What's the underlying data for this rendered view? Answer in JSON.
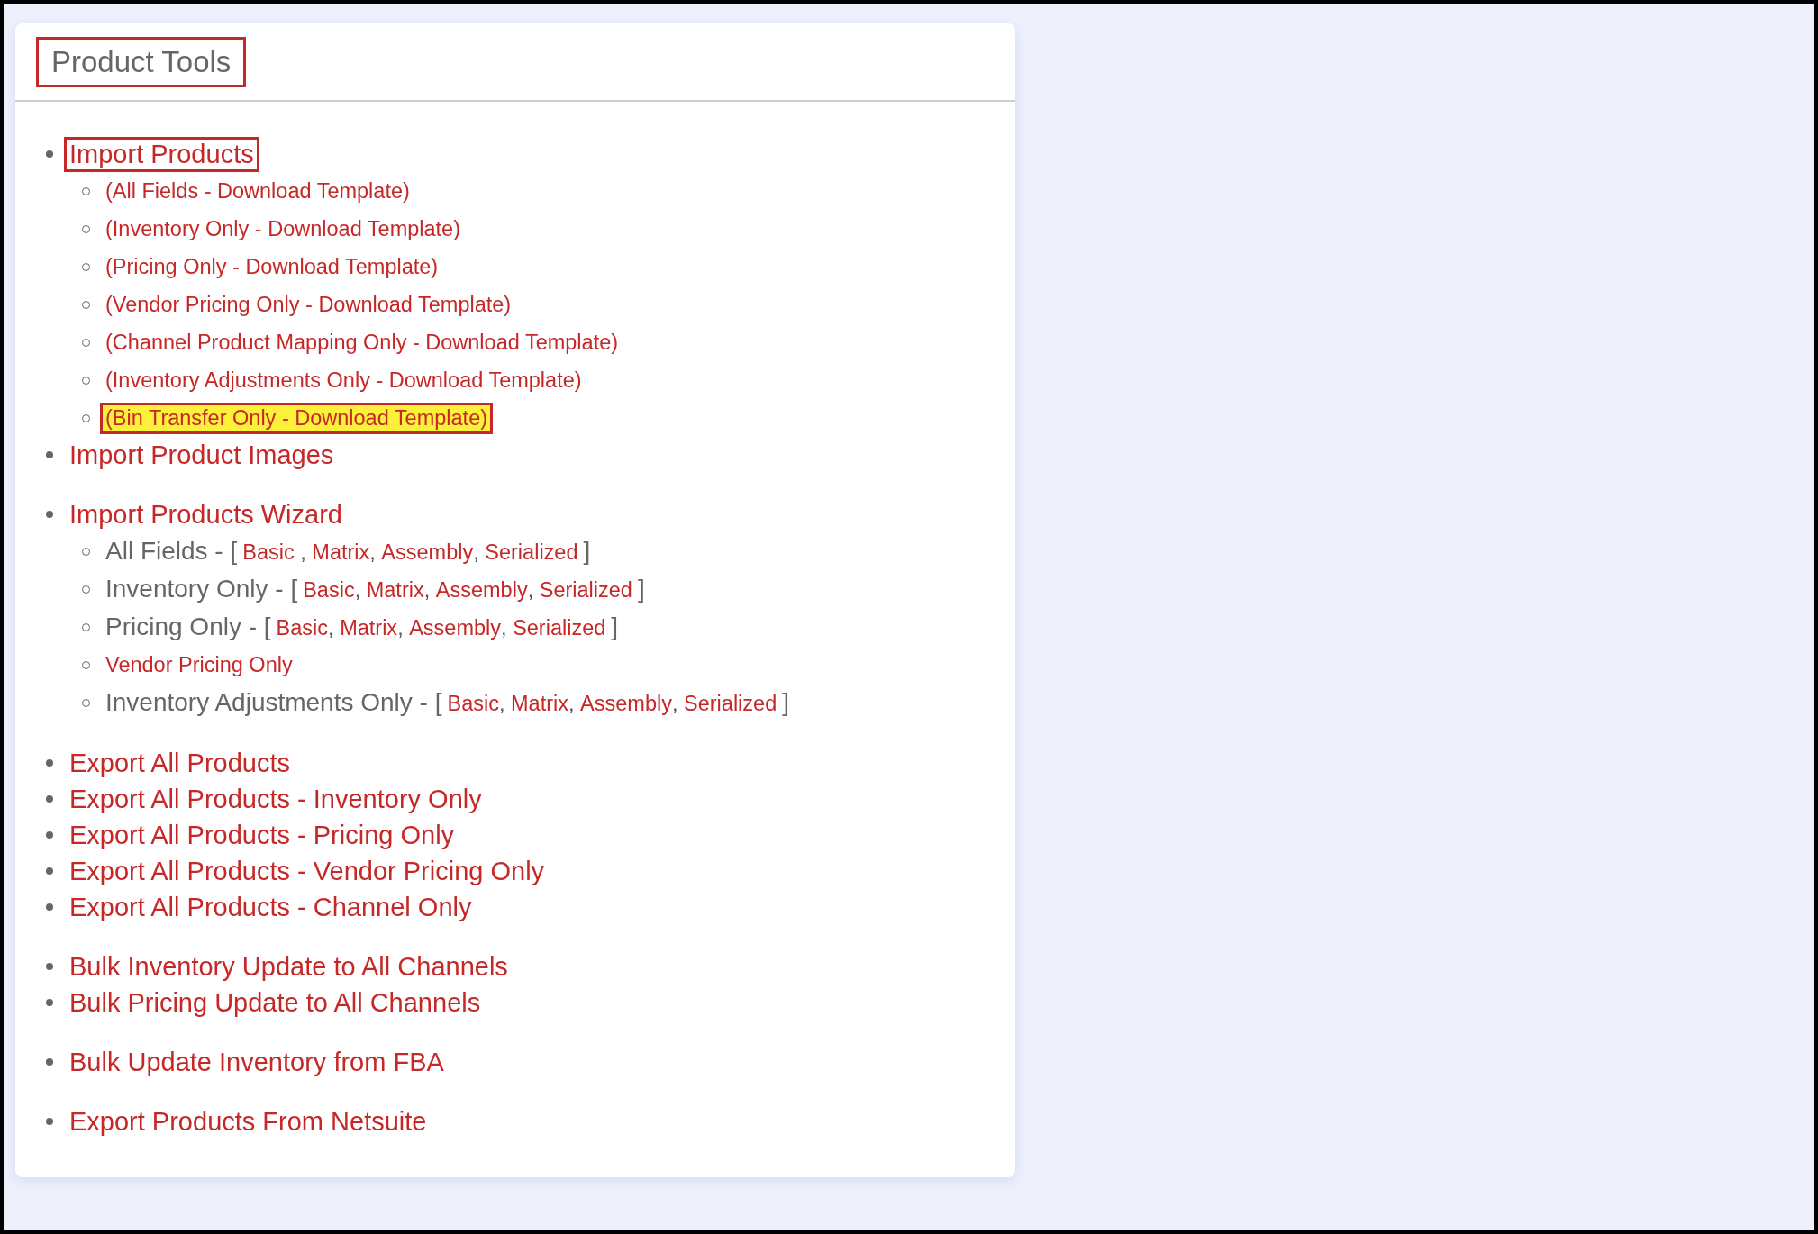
{
  "panel": {
    "title": "Product Tools",
    "outlined": true
  },
  "groups": [
    {
      "items": [
        {
          "label": "Import Products",
          "outlined": true,
          "children": [
            {
              "kind": "link",
              "highlighted": false,
              "parts": [
                {
                  "kind": "link",
                  "text": "(All Fields - Download Template)"
                }
              ]
            },
            {
              "kind": "link",
              "highlighted": false,
              "parts": [
                {
                  "kind": "link",
                  "text": "(Inventory Only - Download Template)"
                }
              ]
            },
            {
              "kind": "link",
              "highlighted": false,
              "parts": [
                {
                  "kind": "link",
                  "text": "(Pricing Only - Download Template)"
                }
              ]
            },
            {
              "kind": "link",
              "highlighted": false,
              "parts": [
                {
                  "kind": "link",
                  "text": "(Vendor Pricing Only - Download Template)"
                }
              ]
            },
            {
              "kind": "link",
              "highlighted": false,
              "parts": [
                {
                  "kind": "link",
                  "text": "(Channel Product Mapping Only - Download Template)"
                }
              ]
            },
            {
              "kind": "link",
              "highlighted": false,
              "parts": [
                {
                  "kind": "link",
                  "text": "(Inventory Adjustments Only - Download Template)"
                }
              ]
            },
            {
              "kind": "link",
              "highlighted": true,
              "parts": [
                {
                  "kind": "link",
                  "text": "(Bin Transfer Only - Download Template)"
                }
              ]
            }
          ]
        },
        {
          "label": "Import Product Images",
          "outlined": false
        }
      ]
    },
    {
      "items": [
        {
          "label": "Import Products Wizard",
          "outlined": false,
          "children": [
            {
              "kind": "wizard",
              "highlighted": false,
              "parts": [
                {
                  "kind": "label",
                  "text": "All Fields - ["
                },
                {
                  "kind": "link",
                  "text": "Basic"
                },
                {
                  "kind": "sep",
                  "text": " , "
                },
                {
                  "kind": "link",
                  "text": "Matrix"
                },
                {
                  "kind": "sep",
                  "text": ", "
                },
                {
                  "kind": "link",
                  "text": "Assembly"
                },
                {
                  "kind": "sep",
                  "text": ", "
                },
                {
                  "kind": "link",
                  "text": "Serialized"
                },
                {
                  "kind": "label",
                  "text": "]"
                }
              ]
            },
            {
              "kind": "wizard",
              "highlighted": false,
              "parts": [
                {
                  "kind": "label",
                  "text": "Inventory Only - ["
                },
                {
                  "kind": "link",
                  "text": "Basic"
                },
                {
                  "kind": "sep",
                  "text": ", "
                },
                {
                  "kind": "link",
                  "text": "Matrix"
                },
                {
                  "kind": "sep",
                  "text": ", "
                },
                {
                  "kind": "link",
                  "text": "Assembly"
                },
                {
                  "kind": "sep",
                  "text": ", "
                },
                {
                  "kind": "link",
                  "text": "Serialized"
                },
                {
                  "kind": "label",
                  "text": "]"
                }
              ]
            },
            {
              "kind": "wizard",
              "highlighted": false,
              "parts": [
                {
                  "kind": "label",
                  "text": "Pricing Only - ["
                },
                {
                  "kind": "link",
                  "text": "Basic"
                },
                {
                  "kind": "sep",
                  "text": ", "
                },
                {
                  "kind": "link",
                  "text": "Matrix"
                },
                {
                  "kind": "sep",
                  "text": ", "
                },
                {
                  "kind": "link",
                  "text": "Assembly"
                },
                {
                  "kind": "sep",
                  "text": ", "
                },
                {
                  "kind": "link",
                  "text": "Serialized"
                },
                {
                  "kind": "label",
                  "text": "]"
                }
              ]
            },
            {
              "kind": "link",
              "highlighted": false,
              "parts": [
                {
                  "kind": "link",
                  "text": "Vendor Pricing Only"
                }
              ]
            },
            {
              "kind": "wizard",
              "highlighted": false,
              "parts": [
                {
                  "kind": "label",
                  "text": "Inventory Adjustments Only - ["
                },
                {
                  "kind": "link",
                  "text": "Basic"
                },
                {
                  "kind": "sep",
                  "text": ", "
                },
                {
                  "kind": "link",
                  "text": "Matrix"
                },
                {
                  "kind": "sep",
                  "text": ", "
                },
                {
                  "kind": "link",
                  "text": "Assembly"
                },
                {
                  "kind": "sep",
                  "text": ", "
                },
                {
                  "kind": "link",
                  "text": "Serialized"
                },
                {
                  "kind": "label",
                  "text": "]"
                }
              ]
            }
          ]
        }
      ]
    },
    {
      "items": [
        {
          "label": "Export All Products",
          "outlined": false
        },
        {
          "label": "Export All Products - Inventory Only",
          "outlined": false
        },
        {
          "label": "Export All Products - Pricing Only",
          "outlined": false
        },
        {
          "label": "Export All Products - Vendor Pricing Only",
          "outlined": false
        },
        {
          "label": "Export All Products - Channel Only",
          "outlined": false
        }
      ]
    },
    {
      "items": [
        {
          "label": "Bulk Inventory Update to All Channels",
          "outlined": false
        },
        {
          "label": "Bulk Pricing Update to All Channels",
          "outlined": false
        }
      ]
    },
    {
      "items": [
        {
          "label": "Bulk Update Inventory from FBA",
          "outlined": false
        }
      ]
    },
    {
      "items": [
        {
          "label": "Export Products From Netsuite",
          "outlined": false
        }
      ]
    }
  ]
}
